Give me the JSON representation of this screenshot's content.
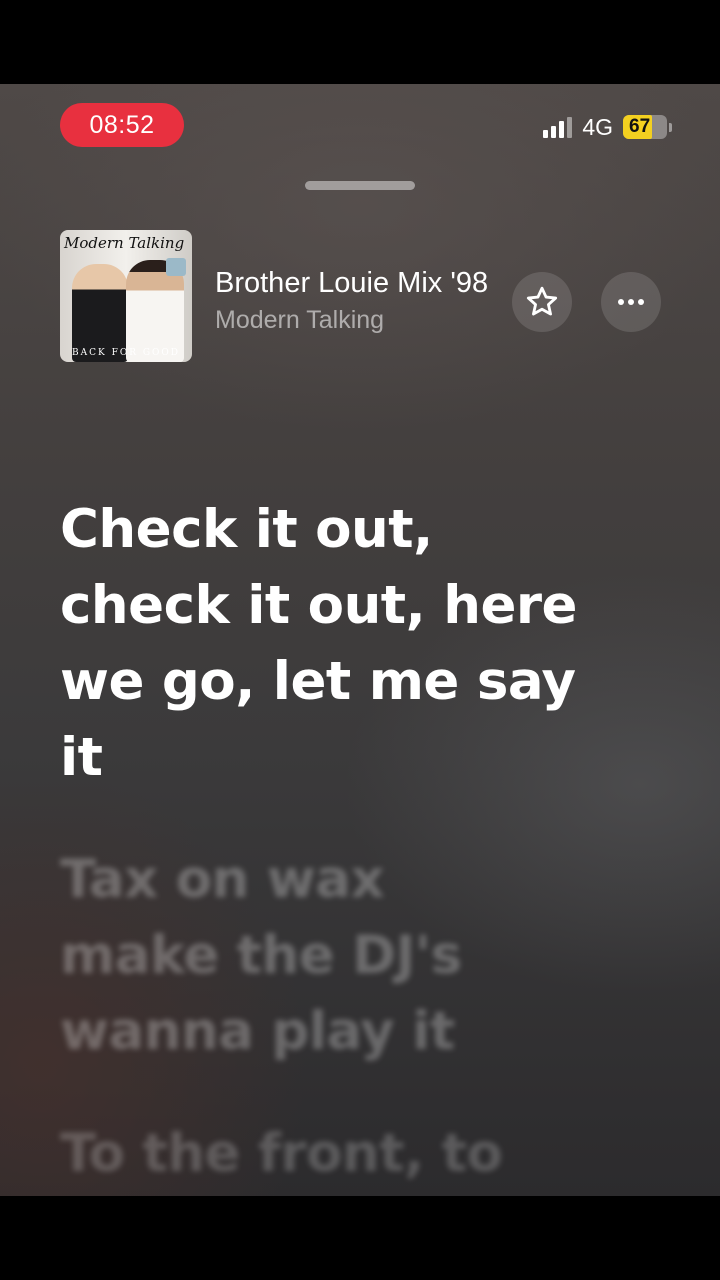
{
  "status_bar": {
    "time": "08:52",
    "network": "4G",
    "battery": "67",
    "battery_level_percent": 67
  },
  "now_playing": {
    "album_art_title": "Modern Talking",
    "album_art_footer": "BACK FOR GOOD",
    "song_title": "Brother Louie Mix '98",
    "artist": "Modern Talking",
    "favorite_icon": "star-icon",
    "more_icon": "ellipsis-icon"
  },
  "lyrics": {
    "current": "Check it out, check it out, here we go, let me say it",
    "next": "Tax on wax make the DJ's wanna play it",
    "following": "To the front, to"
  },
  "colors": {
    "time_pill": "#e8303f",
    "battery_fill": "#f3d020"
  }
}
